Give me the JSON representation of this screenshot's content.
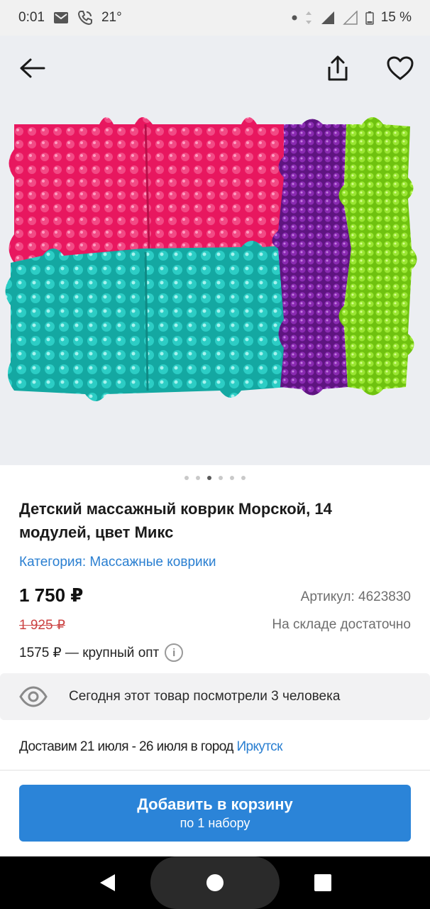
{
  "status_bar": {
    "time": "0:01",
    "temperature": "21°",
    "battery": "15 %"
  },
  "product": {
    "title": "Детский массажный коврик Морской, 14 модулей, цвет Микс",
    "category": "Категория: Массажные коврики",
    "price": "1 750 ₽",
    "article": "Артикул: 4623830",
    "old_price": "1 925 ₽",
    "stock": "На складе достаточно",
    "wholesale": "1575 ₽ — крупный опт",
    "image_count": 6,
    "active_image_index": 2,
    "colors": {
      "pink": "#e8175f",
      "teal": "#1bbdb6",
      "purple": "#7a1c9e",
      "green": "#8fe024"
    }
  },
  "views": {
    "text": "Сегодня этот товар посмотрели 3 человека"
  },
  "delivery": {
    "text": "Доставим 21 июля - 26 июля в город",
    "city": "Иркутск"
  },
  "cart_button": {
    "label": "Добавить в корзину",
    "sublabel": "по 1 набору"
  },
  "icons": {
    "back": "arrow-left-icon",
    "share": "share-icon",
    "favorite": "heart-icon",
    "info": "info-icon",
    "eye": "eye-icon"
  },
  "accent_color": "#2b84d8"
}
